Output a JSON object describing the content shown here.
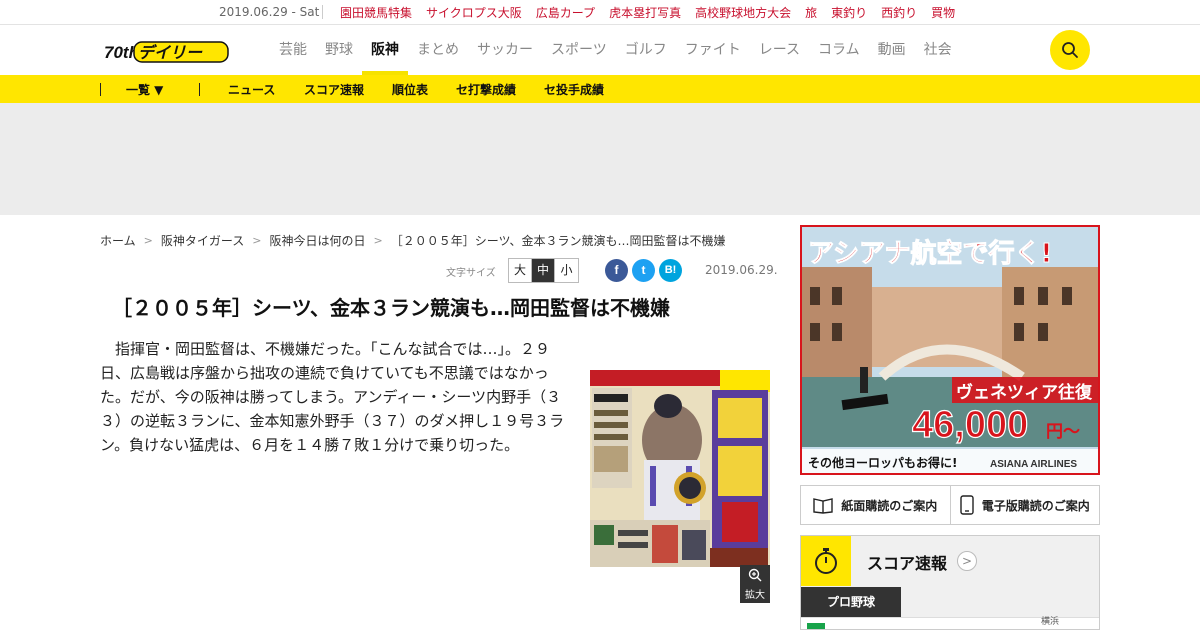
{
  "topbar": {
    "date": "2019.06.29 - Sat",
    "links": [
      "園田競馬特集",
      "サイクロプス大阪",
      "広島カープ",
      "虎本塁打写真",
      "高校野球地方大会",
      "旅",
      "東釣り",
      "西釣り",
      "買物"
    ]
  },
  "header": {
    "logo_text": "デイリー",
    "logo_badge": "70th",
    "nav": [
      "芸能",
      "野球",
      "阪神",
      "まとめ",
      "サッカー",
      "スポーツ",
      "ゴルフ",
      "ファイト",
      "レース",
      "コラム",
      "動画",
      "社会"
    ],
    "active_nav": "阪神"
  },
  "subnav": {
    "list_label": "一覧 ▼",
    "items": [
      "ニュース",
      "スコア速報",
      "順位表",
      "セ打撃成績",
      "セ投手成績"
    ]
  },
  "breadcrumb": [
    "ホーム",
    "阪神タイガース",
    "阪神今日は何の日",
    "［２００５年］シーツ、金本３ラン競演も…岡田監督は不機嫌"
  ],
  "article_tools": {
    "font_size_label": "文字サイズ",
    "sizes": [
      "大",
      "中",
      "小"
    ],
    "selected_size": "中",
    "share": [
      "f",
      "t",
      "B!"
    ],
    "date": "2019.06.29."
  },
  "article": {
    "headline": "［２００５年］シーツ、金本３ラン競演も…岡田監督は不機嫌",
    "body": "　指揮官・岡田監督は、不機嫌だった。「こんな試合では…」。２９日、広島戦は序盤から拙攻の連続で負けていても不思議ではなかった。だが、今の阪神は勝ってしまう。アンディー・シーツ内野手（３３）の逆転３ランに、金本知憲外野手（３７）のダメ押し１９号３ラン。負けない猛虎は、６月を１４勝７敗１分けで乗り切った。",
    "zoom_label": "拡大"
  },
  "sidebar": {
    "ad": {
      "headline": "アシアナ航空で行く!",
      "route": "ヴェネツィア往復",
      "price": "46,000",
      "price_unit": "円～",
      "note": "その他ヨーロッパもお得に!",
      "brand": "ASIANA AIRLINES"
    },
    "subscribe_paper": "紙面購読のご案内",
    "subscribe_digital": "電子版購読のご案内",
    "score_title": "スコア速報",
    "score_tab": "プロ野球",
    "score_partial": "横浜"
  },
  "colors": {
    "brand_yellow": "#ffe600",
    "link_red": "#c8102e",
    "ad_red": "#d8141c"
  }
}
